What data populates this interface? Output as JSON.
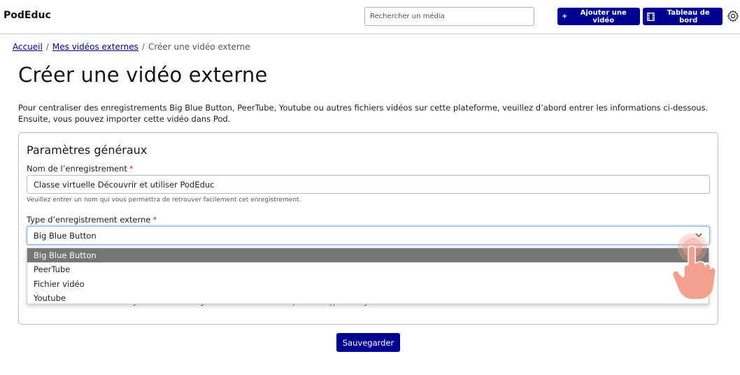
{
  "header": {
    "brand": "PodEduc",
    "search_placeholder": "Rechercher un média",
    "add_video_label": "Ajouter une vidéo",
    "add_icon": "plus-icon",
    "dashboard_label": "Tableau de bord",
    "dashboard_icon": "film-icon",
    "settings_icon": "gear-icon"
  },
  "breadcrumb": {
    "home": "Accueil",
    "sep1": "/",
    "my_videos": "Mes vidéos externes",
    "sep2": "/",
    "current": "Créer une vidéo externe"
  },
  "page": {
    "title": "Créer une vidéo externe",
    "intro_line1": "Pour centraliser des enregistrements Big Blue Button, PeerTube, Youtube ou autres fichiers vidéos sur cette plateforme, veuillez d’abord entrer les informations ci-dessous.",
    "intro_line2": "Ensuite, vous pouvez importer cette vidéo dans Pod."
  },
  "form": {
    "section_title": "Paramètres généraux",
    "name_label": "Nom de l’enregistrement",
    "required_mark": "*",
    "name_value": "Classe virtuelle Découvrir et utiliser PodEduc",
    "name_help": "Veuillez entrer un nom qui vous permettra de retrouver facilement cet enregistrement.",
    "type_label": "Type d’enregistrement externe",
    "type_value": "Big Blue Button",
    "type_options": [
      "Big Blue Button",
      "PeerTube",
      "Fichier vidéo",
      "Youtube"
    ],
    "url_help": "Veuillez entrer l’adresse de l’enregistrement à télécharger. Cette adresse doit correspondre au type d’enregistrement sélectionné.",
    "save_label": "Sauvegarder"
  },
  "colors": {
    "primary": "#000091",
    "required": "#d6282d",
    "option_selected_bg": "#767676",
    "pointer": "#f3a08e"
  }
}
